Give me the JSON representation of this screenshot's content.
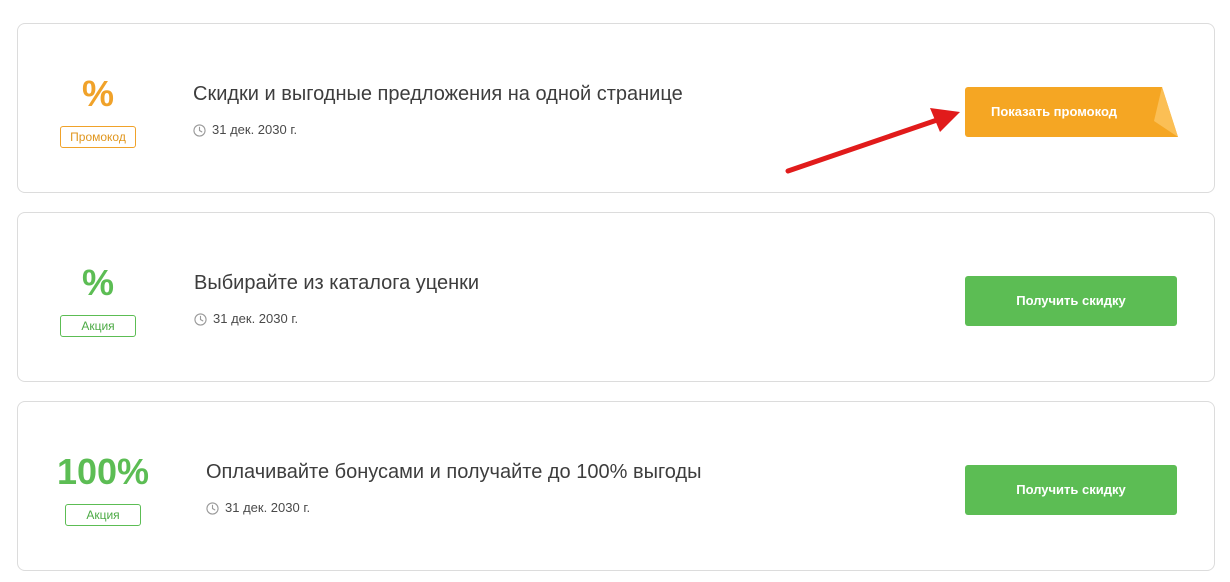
{
  "colors": {
    "orange": "#f0a22a",
    "green": "#5cbd54",
    "arrow_red": "#e11b1b"
  },
  "offers": [
    {
      "value": "%",
      "tag": "Промокод",
      "title": "Скидки и выгодные предложения на одной странице",
      "date": "31 дек. 2030 г.",
      "button_label": "Показать промокод"
    },
    {
      "value": "%",
      "tag": "Акция",
      "title": "Выбирайте из каталога уценки",
      "date": "31 дек. 2030 г.",
      "button_label": "Получить скидку"
    },
    {
      "value": "100%",
      "tag": "Акция",
      "title": "Оплачивайте бонусами и получайте до 100% выгоды",
      "date": "31 дек. 2030 г.",
      "button_label": "Получить скидку"
    }
  ],
  "icons": {
    "date": "clock-icon",
    "pointer": "red-arrow-icon"
  }
}
